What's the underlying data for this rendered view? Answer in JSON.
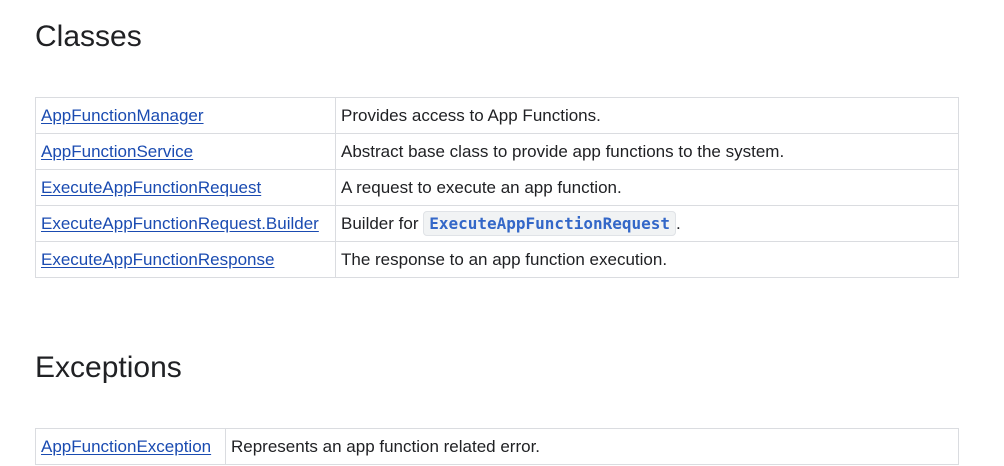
{
  "classes": {
    "heading": "Classes",
    "rows": [
      {
        "name": "AppFunctionManager",
        "description": "Provides access to App Functions."
      },
      {
        "name": "AppFunctionService",
        "description": "Abstract base class to provide app functions to the system."
      },
      {
        "name": "ExecuteAppFunctionRequest",
        "description": "A request to execute an app function."
      },
      {
        "name": "ExecuteAppFunctionRequest.Builder",
        "description_prefix": "Builder for ",
        "description_code": "ExecuteAppFunctionRequest",
        "description_suffix": "."
      },
      {
        "name": "ExecuteAppFunctionResponse",
        "description": "The response to an app function execution."
      }
    ]
  },
  "exceptions": {
    "heading": "Exceptions",
    "rows": [
      {
        "name": "AppFunctionException",
        "description": "Represents an app function related error."
      }
    ]
  },
  "colors": {
    "link": "#1a4bb1",
    "text": "#202124",
    "border": "#dadce0",
    "code": "#3367c8"
  }
}
